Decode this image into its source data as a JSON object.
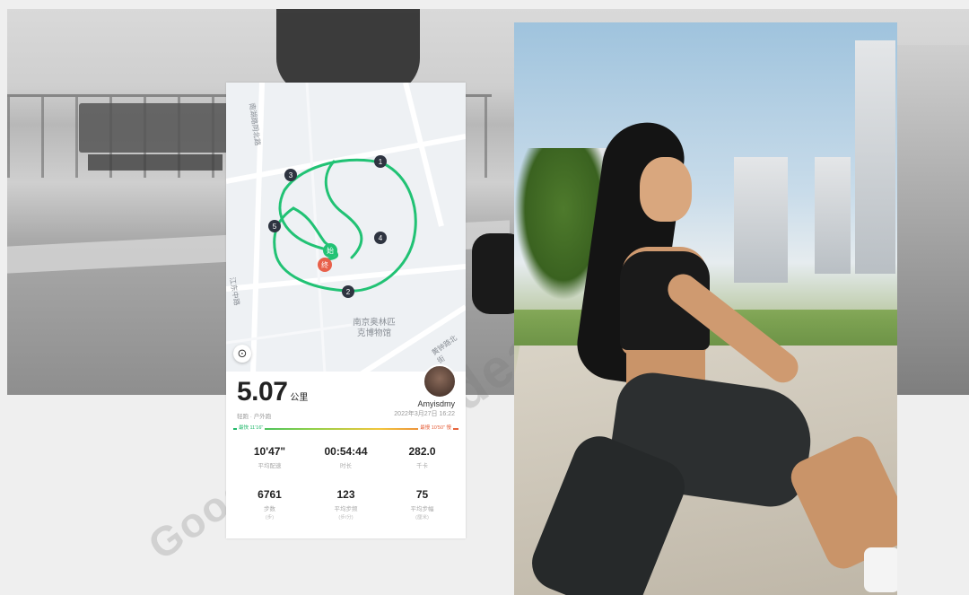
{
  "watermark": {
    "text": "Goodidea"
  },
  "map": {
    "road_labels": [
      "南湖路同北路",
      "江东中路",
      "黄钟路北街"
    ],
    "poi": {
      "line1": "南京奥林匹",
      "line2": "克博物馆"
    },
    "markers": [
      "1",
      "2",
      "3",
      "4",
      "5"
    ],
    "start_label": "始",
    "end_label": "终",
    "route_color": "#21c274",
    "marker_color": "#2e3440"
  },
  "summary": {
    "distance": "5.07",
    "distance_unit": "公里",
    "activity": "轻跑 · 户外跑",
    "username": "Amyisdmy",
    "datetime": "2022年3月27日 16:22",
    "pace_min_label": "最快 11'16\"",
    "pace_max_label": "最慢 10'50\" 慢"
  },
  "metrics": [
    {
      "value": "10'47\"",
      "label": "平均配速",
      "sub": ""
    },
    {
      "value": "00:54:44",
      "label": "时长",
      "sub": ""
    },
    {
      "value": "282.0",
      "label": "千卡",
      "sub": ""
    },
    {
      "value": "6761",
      "label": "步数",
      "sub": "(步)"
    },
    {
      "value": "123",
      "label": "平均步频",
      "sub": "(步/分)"
    },
    {
      "value": "75",
      "label": "平均步幅",
      "sub": "(厘米)"
    }
  ]
}
